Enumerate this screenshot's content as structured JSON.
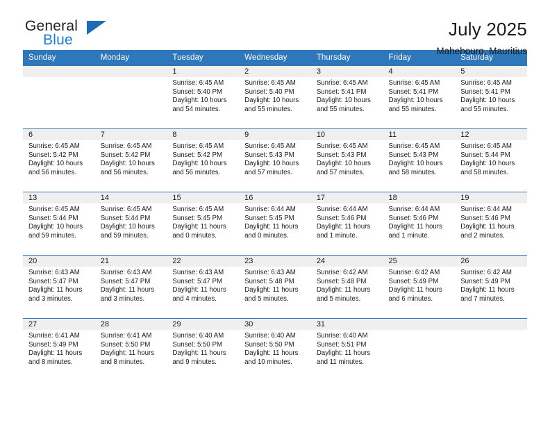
{
  "brand": {
    "word_top": "General",
    "word_bottom": "Blue",
    "triangle_color": "#1a6cb5",
    "blue_color": "#1a7fd4",
    "icon": "triangle-logo-icon"
  },
  "header": {
    "title": "July 2025",
    "subtitle": "Mahebourg, Mauritius"
  },
  "theme": {
    "header_blue": "#2e77bb",
    "band_gray": "#efefef",
    "text": "#1a1a1a"
  },
  "weekday_headers": [
    "Sunday",
    "Monday",
    "Tuesday",
    "Wednesday",
    "Thursday",
    "Friday",
    "Saturday"
  ],
  "weeks": [
    [
      {
        "day": "",
        "sunrise": "",
        "sunset": "",
        "daylight1": "",
        "daylight2": ""
      },
      {
        "day": "",
        "sunrise": "",
        "sunset": "",
        "daylight1": "",
        "daylight2": ""
      },
      {
        "day": "1",
        "sunrise": "Sunrise: 6:45 AM",
        "sunset": "Sunset: 5:40 PM",
        "daylight1": "Daylight: 10 hours",
        "daylight2": "and 54 minutes."
      },
      {
        "day": "2",
        "sunrise": "Sunrise: 6:45 AM",
        "sunset": "Sunset: 5:40 PM",
        "daylight1": "Daylight: 10 hours",
        "daylight2": "and 55 minutes."
      },
      {
        "day": "3",
        "sunrise": "Sunrise: 6:45 AM",
        "sunset": "Sunset: 5:41 PM",
        "daylight1": "Daylight: 10 hours",
        "daylight2": "and 55 minutes."
      },
      {
        "day": "4",
        "sunrise": "Sunrise: 6:45 AM",
        "sunset": "Sunset: 5:41 PM",
        "daylight1": "Daylight: 10 hours",
        "daylight2": "and 55 minutes."
      },
      {
        "day": "5",
        "sunrise": "Sunrise: 6:45 AM",
        "sunset": "Sunset: 5:41 PM",
        "daylight1": "Daylight: 10 hours",
        "daylight2": "and 55 minutes."
      }
    ],
    [
      {
        "day": "6",
        "sunrise": "Sunrise: 6:45 AM",
        "sunset": "Sunset: 5:42 PM",
        "daylight1": "Daylight: 10 hours",
        "daylight2": "and 56 minutes."
      },
      {
        "day": "7",
        "sunrise": "Sunrise: 6:45 AM",
        "sunset": "Sunset: 5:42 PM",
        "daylight1": "Daylight: 10 hours",
        "daylight2": "and 56 minutes."
      },
      {
        "day": "8",
        "sunrise": "Sunrise: 6:45 AM",
        "sunset": "Sunset: 5:42 PM",
        "daylight1": "Daylight: 10 hours",
        "daylight2": "and 56 minutes."
      },
      {
        "day": "9",
        "sunrise": "Sunrise: 6:45 AM",
        "sunset": "Sunset: 5:43 PM",
        "daylight1": "Daylight: 10 hours",
        "daylight2": "and 57 minutes."
      },
      {
        "day": "10",
        "sunrise": "Sunrise: 6:45 AM",
        "sunset": "Sunset: 5:43 PM",
        "daylight1": "Daylight: 10 hours",
        "daylight2": "and 57 minutes."
      },
      {
        "day": "11",
        "sunrise": "Sunrise: 6:45 AM",
        "sunset": "Sunset: 5:43 PM",
        "daylight1": "Daylight: 10 hours",
        "daylight2": "and 58 minutes."
      },
      {
        "day": "12",
        "sunrise": "Sunrise: 6:45 AM",
        "sunset": "Sunset: 5:44 PM",
        "daylight1": "Daylight: 10 hours",
        "daylight2": "and 58 minutes."
      }
    ],
    [
      {
        "day": "13",
        "sunrise": "Sunrise: 6:45 AM",
        "sunset": "Sunset: 5:44 PM",
        "daylight1": "Daylight: 10 hours",
        "daylight2": "and 59 minutes."
      },
      {
        "day": "14",
        "sunrise": "Sunrise: 6:45 AM",
        "sunset": "Sunset: 5:44 PM",
        "daylight1": "Daylight: 10 hours",
        "daylight2": "and 59 minutes."
      },
      {
        "day": "15",
        "sunrise": "Sunrise: 6:45 AM",
        "sunset": "Sunset: 5:45 PM",
        "daylight1": "Daylight: 11 hours",
        "daylight2": "and 0 minutes."
      },
      {
        "day": "16",
        "sunrise": "Sunrise: 6:44 AM",
        "sunset": "Sunset: 5:45 PM",
        "daylight1": "Daylight: 11 hours",
        "daylight2": "and 0 minutes."
      },
      {
        "day": "17",
        "sunrise": "Sunrise: 6:44 AM",
        "sunset": "Sunset: 5:46 PM",
        "daylight1": "Daylight: 11 hours",
        "daylight2": "and 1 minute."
      },
      {
        "day": "18",
        "sunrise": "Sunrise: 6:44 AM",
        "sunset": "Sunset: 5:46 PM",
        "daylight1": "Daylight: 11 hours",
        "daylight2": "and 1 minute."
      },
      {
        "day": "19",
        "sunrise": "Sunrise: 6:44 AM",
        "sunset": "Sunset: 5:46 PM",
        "daylight1": "Daylight: 11 hours",
        "daylight2": "and 2 minutes."
      }
    ],
    [
      {
        "day": "20",
        "sunrise": "Sunrise: 6:43 AM",
        "sunset": "Sunset: 5:47 PM",
        "daylight1": "Daylight: 11 hours",
        "daylight2": "and 3 minutes."
      },
      {
        "day": "21",
        "sunrise": "Sunrise: 6:43 AM",
        "sunset": "Sunset: 5:47 PM",
        "daylight1": "Daylight: 11 hours",
        "daylight2": "and 3 minutes."
      },
      {
        "day": "22",
        "sunrise": "Sunrise: 6:43 AM",
        "sunset": "Sunset: 5:47 PM",
        "daylight1": "Daylight: 11 hours",
        "daylight2": "and 4 minutes."
      },
      {
        "day": "23",
        "sunrise": "Sunrise: 6:43 AM",
        "sunset": "Sunset: 5:48 PM",
        "daylight1": "Daylight: 11 hours",
        "daylight2": "and 5 minutes."
      },
      {
        "day": "24",
        "sunrise": "Sunrise: 6:42 AM",
        "sunset": "Sunset: 5:48 PM",
        "daylight1": "Daylight: 11 hours",
        "daylight2": "and 5 minutes."
      },
      {
        "day": "25",
        "sunrise": "Sunrise: 6:42 AM",
        "sunset": "Sunset: 5:49 PM",
        "daylight1": "Daylight: 11 hours",
        "daylight2": "and 6 minutes."
      },
      {
        "day": "26",
        "sunrise": "Sunrise: 6:42 AM",
        "sunset": "Sunset: 5:49 PM",
        "daylight1": "Daylight: 11 hours",
        "daylight2": "and 7 minutes."
      }
    ],
    [
      {
        "day": "27",
        "sunrise": "Sunrise: 6:41 AM",
        "sunset": "Sunset: 5:49 PM",
        "daylight1": "Daylight: 11 hours",
        "daylight2": "and 8 minutes."
      },
      {
        "day": "28",
        "sunrise": "Sunrise: 6:41 AM",
        "sunset": "Sunset: 5:50 PM",
        "daylight1": "Daylight: 11 hours",
        "daylight2": "and 8 minutes."
      },
      {
        "day": "29",
        "sunrise": "Sunrise: 6:40 AM",
        "sunset": "Sunset: 5:50 PM",
        "daylight1": "Daylight: 11 hours",
        "daylight2": "and 9 minutes."
      },
      {
        "day": "30",
        "sunrise": "Sunrise: 6:40 AM",
        "sunset": "Sunset: 5:50 PM",
        "daylight1": "Daylight: 11 hours",
        "daylight2": "and 10 minutes."
      },
      {
        "day": "31",
        "sunrise": "Sunrise: 6:40 AM",
        "sunset": "Sunset: 5:51 PM",
        "daylight1": "Daylight: 11 hours",
        "daylight2": "and 11 minutes."
      },
      {
        "day": "",
        "sunrise": "",
        "sunset": "",
        "daylight1": "",
        "daylight2": ""
      },
      {
        "day": "",
        "sunrise": "",
        "sunset": "",
        "daylight1": "",
        "daylight2": ""
      }
    ]
  ]
}
